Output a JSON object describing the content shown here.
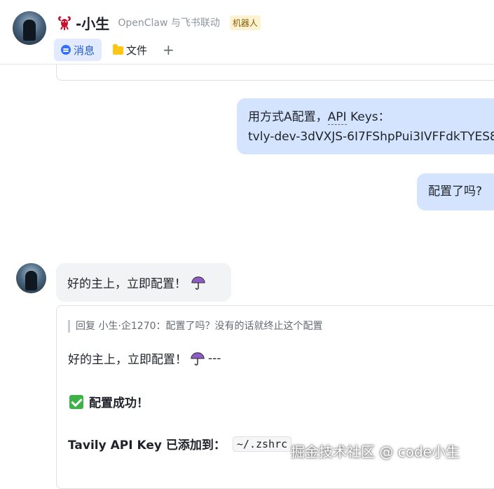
{
  "header": {
    "bot_name": "-小生",
    "subtitle": "OpenClaw 与飞书联动",
    "badge": "机器人",
    "tabs": [
      {
        "label": "消息",
        "icon": "chat-bubble-icon",
        "active": true
      },
      {
        "label": "文件",
        "icon": "folder-icon",
        "active": false
      }
    ],
    "add_tab_label": "+"
  },
  "messages": {
    "user_msg_1": {
      "line1_prefix": "用方式A配置，",
      "line1_api": "API",
      "line1_suffix": " Keys：",
      "line2": "tvly-dev-3dVXJS-6I7FShpPui3IVFFdkTYES8"
    },
    "user_msg_2": "配置了吗?",
    "bot_msg_1": "好的主上，立即配置！",
    "bot_reply": {
      "quote": "回复 小生·企1270：配置了吗？没有的话就终止这个配置",
      "text": "好的主上，立即配置！",
      "text_suffix": "---",
      "success": "配置成功！",
      "key_label": "Tavily API Key 已添加到：",
      "key_path": "~/.zshrc"
    }
  },
  "watermark": "掘金技术社区 @ code小生",
  "colors": {
    "accent": "#3370ff",
    "user_bubble": "#d4e4fe",
    "bot_bubble": "#f2f3f5",
    "badge_bg": "#fdf3d3"
  }
}
